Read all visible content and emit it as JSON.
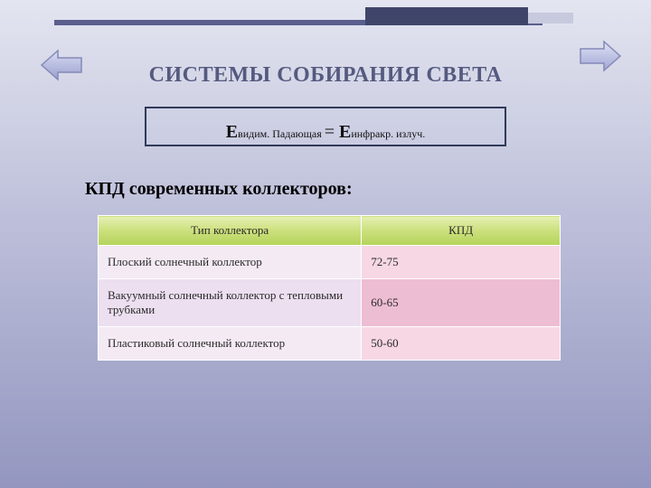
{
  "title": "СИСТЕМЫ СОБИРАНИЯ СВЕТА",
  "formula": {
    "E1": "Е",
    "sub1": "видим. Падающая ",
    "eq": "= ",
    "E2": "Е",
    "sub2": "инфракр. излуч."
  },
  "subtitle": "КПД современных коллекторов:",
  "table": {
    "headers": {
      "type": "Тип коллектора",
      "eff": "КПД"
    },
    "rows": [
      {
        "type": "Плоский солнечный коллектор",
        "eff": "72-75"
      },
      {
        "type": "Вакуумный солнечный коллектор с тепловыми трубками",
        "eff": "60-65"
      },
      {
        "type": "Пластиковый солнечный коллектор",
        "eff": "50-60"
      }
    ]
  }
}
